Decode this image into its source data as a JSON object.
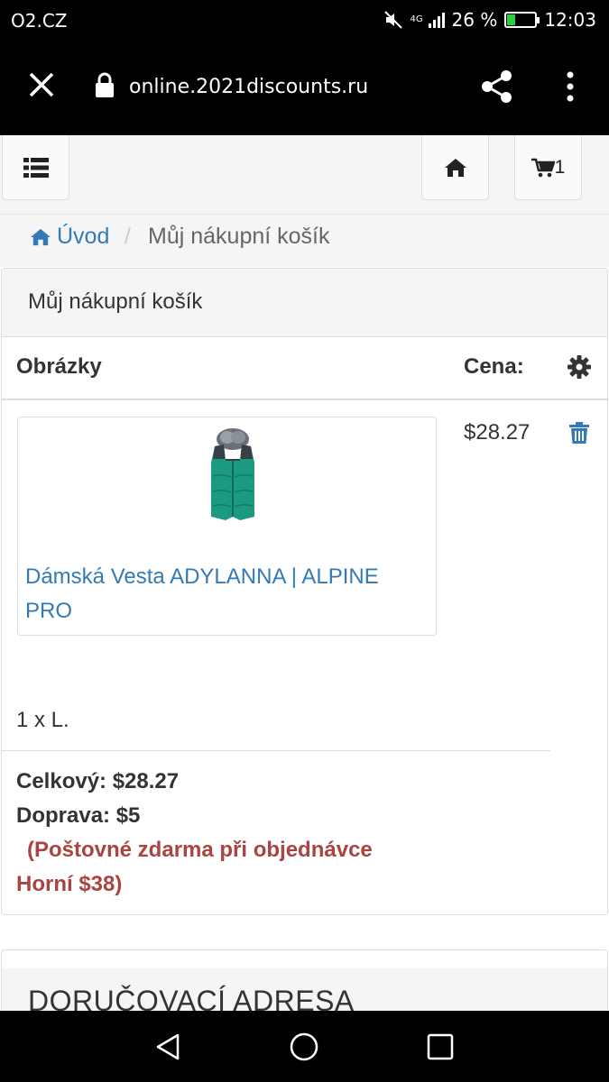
{
  "status_bar": {
    "carrier": "O2.CZ",
    "network": "4G",
    "battery_percent": "26 %",
    "time": "12:03"
  },
  "browser": {
    "url": "online.2021discounts.ru"
  },
  "nav": {
    "cart_count": "1"
  },
  "breadcrumb": {
    "home": "Úvod",
    "separator": "/",
    "current": "Můj nákupní košík"
  },
  "cart": {
    "title": "Můj nákupní košík",
    "col_images": "Obrázky",
    "col_price": "Cena:",
    "item": {
      "name": "Dámská Vesta ADYLANNA | ALPINE PRO",
      "price": "$28.27",
      "qty_size": "1 x L."
    },
    "total": "Celkový: $28.27",
    "shipping": "Doprava: $5",
    "free_shipping_note": "(Poštovné zdarma při objednávce Horní $38)"
  },
  "delivery": {
    "title": "DORUČOVACÍ ADRESA"
  },
  "colors": {
    "link": "#337ab7",
    "warning": "#a94442",
    "panel_bg": "#f5f5f5",
    "vest_teal": "#1a9a80",
    "vest_dark": "#3a3f45"
  },
  "icons": [
    "close-icon",
    "lock-icon",
    "share-icon",
    "more-icon",
    "menu-list-icon",
    "home-icon",
    "cart-icon",
    "gear-icon",
    "trash-icon",
    "back-icon",
    "home-circle-icon",
    "recents-icon"
  ]
}
